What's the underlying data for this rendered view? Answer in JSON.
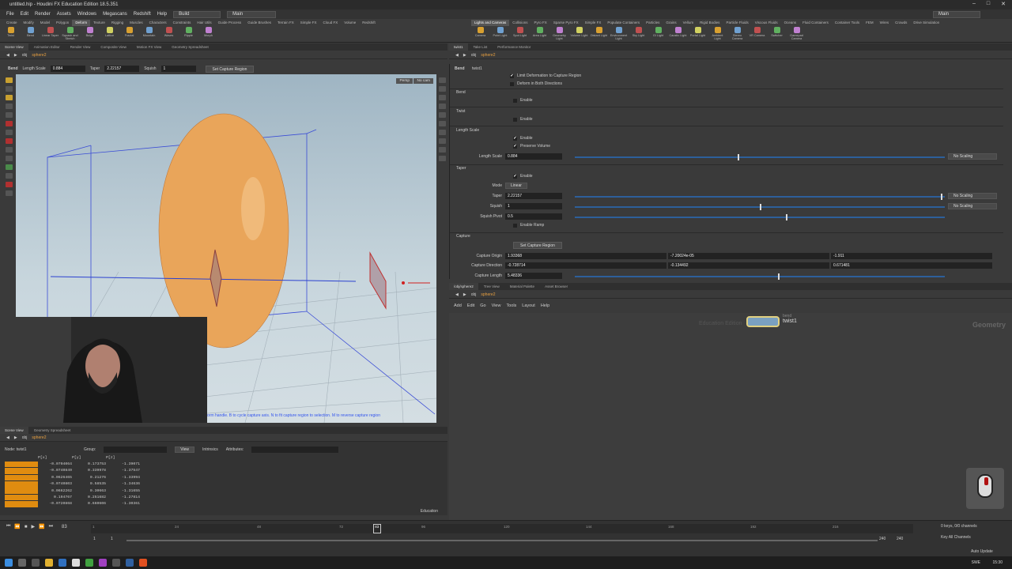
{
  "window": {
    "title": "untitled.hip - Houdini FX Education Edition 18.5.351"
  },
  "menu": [
    "File",
    "Edit",
    "Render",
    "Assets",
    "Windows",
    "Megascans",
    "Redshift",
    "Help"
  ],
  "desktop_build": "Build",
  "desktop_main": "Main",
  "right_main": "Main",
  "shelf": {
    "left_tabs": [
      "Create",
      "Modify",
      "Model",
      "Polygon",
      "Deform",
      "Texture",
      "Rigging",
      "Muscles",
      "Characters",
      "Constraints",
      "Hair Utils",
      "Guide Process",
      "Guide Brushes",
      "Terrain FX",
      "Simple FX",
      "Cloud FX",
      "Volume",
      "Redshift"
    ],
    "left_active": "Deform",
    "left_tools": [
      "Twist",
      "Bend",
      "Linear Taper",
      "Squash and Stretch",
      "Bulge",
      "Lattice",
      "Fractal",
      "Mountain",
      "Waves",
      "Ripple",
      "Morph"
    ],
    "right_tabs": [
      "Lights and Cameras",
      "Collisions",
      "Pyro FX",
      "Sparse Pyro FX",
      "Simple FX",
      "Populate Containers",
      "Particles",
      "Grains",
      "Vellum",
      "Rigid Bodies",
      "Particle Fluids",
      "Viscous Fluids",
      "Oceans",
      "Fluid Containers",
      "Container Tools",
      "FEM",
      "Wires",
      "Crowds",
      "Drive Simulation"
    ],
    "right_active": "Lights and Cameras",
    "right_tools": [
      "Camera",
      "Point Light",
      "Spot Light",
      "Area Light",
      "Geometry Light",
      "Volume Light",
      "Distant Light",
      "Environment Light",
      "Sky Light",
      "GI Light",
      "Caustic Light",
      "Portal Light",
      "Ambient Light",
      "Stereo Camera",
      "VR Camera",
      "Switcher",
      "Gamepad Camera"
    ]
  },
  "viewer": {
    "tabs": [
      "Scene View",
      "Animation Editor",
      "Render View",
      "Composite View",
      "Motion FX View",
      "Geometry Spreadsheet"
    ],
    "path": [
      "obj",
      "sphere2"
    ],
    "tool": "Bend",
    "length_scale_label": "Length Scale",
    "length_scale": "0.884",
    "taper_label": "Taper",
    "taper": "2.22157",
    "squish_label": "Squish",
    "squish": "1",
    "capture_btn": "Set Capture Region",
    "persp": "Persp",
    "cam": "No cam",
    "status": "orm handle. B to cycle capture axis. N to fit capture region to selection. M to reverse capture region"
  },
  "params": {
    "tabs": [
      "twist1",
      "Take List",
      "Performance Monitor"
    ],
    "path": [
      "obj",
      "sphere2"
    ],
    "node_type": "Bend",
    "node_name": "twist1",
    "limit": "Limit Deformation to Capture Region",
    "both": "Deform in Both Directions",
    "bend": "Bend",
    "twist": "Twist",
    "enable": "Enable",
    "lengthscale_sec": "Length Scale",
    "preserve": "Preserve Volume",
    "length_scale_label": "Length Scale",
    "length_scale": "0.884",
    "no_scaling": "No Scaling",
    "taper_sec": "Taper",
    "mode_label": "Mode",
    "mode": "Linear",
    "taper_label": "Taper",
    "taper": "2.22157",
    "squish_label": "Squish",
    "squish": "1",
    "pivot_label": "Squish Pivot",
    "pivot": "0.5",
    "enable_ramp": "Enable Ramp",
    "capture_sec": "Capture",
    "capture_btn": "Set Capture Region",
    "origin_label": "Capture Origin",
    "origin": [
      "1.93368",
      "-7.20024e-05",
      "-1.911"
    ],
    "dir_label": "Capture Direction",
    "dir": [
      "-0.728714",
      "-0.134492",
      "0.671481"
    ],
    "clen_label": "Capture Length",
    "clen": "5.48336",
    "slider_fraction": {
      "length_scale": 0.44,
      "taper": 0.99,
      "squish": 0.5,
      "pivot": 0.57,
      "clen": 0.55
    }
  },
  "network": {
    "tabs": [
      "/obj/sphere2",
      "Tree View",
      "Material Palette",
      "Asset Browser"
    ],
    "path": [
      "obj",
      "sphere2"
    ],
    "menu": [
      "Add",
      "Edit",
      "Go",
      "View",
      "Tools",
      "Layout",
      "Help"
    ],
    "node_type": "bend",
    "node_name": "twist1",
    "edu": "Education Edition",
    "context": "Geometry"
  },
  "spreadsheet": {
    "tabs": [
      "Scene View",
      "Geometry Spreadsheet"
    ],
    "path": [
      "obj",
      "sphere2"
    ],
    "node": "Node: twist1",
    "group": "Group:",
    "view": "View",
    "intrinsics": "Intrinsics",
    "attributes": "Attributes:",
    "headers": [
      "P[x]",
      "P[y]",
      "P[z]"
    ],
    "rows": [
      [
        "-0.0704064",
        "0.173753",
        "-1.39071"
      ],
      [
        "-0.0740849",
        "0.339978",
        "-1.37547"
      ],
      [
        "0.0626465",
        "0.21276",
        "-1.33994"
      ],
      [
        "-0.0740803",
        "0.58535",
        "-1.34636"
      ],
      [
        "0.0662262",
        "0.30663",
        "-1.31655"
      ],
      [
        "0.194767",
        "0.251682",
        "-1.27814"
      ],
      [
        "-0.0720868",
        "0.660606",
        "-1.30361"
      ]
    ],
    "edu": "Education"
  },
  "timeline": {
    "frame": "83",
    "ticks": [
      "1",
      "24",
      "48",
      "72",
      "96",
      "120",
      "144",
      "168",
      "192",
      "216"
    ],
    "start": "1",
    "start2": "1",
    "end": "240",
    "end2": "240",
    "keys": "0 keys, 0/0 channels",
    "keyall": "Key All Channels",
    "autoupdate": "Auto Update"
  },
  "taskbar": {
    "lang": "SWE",
    "time": "15:30"
  }
}
